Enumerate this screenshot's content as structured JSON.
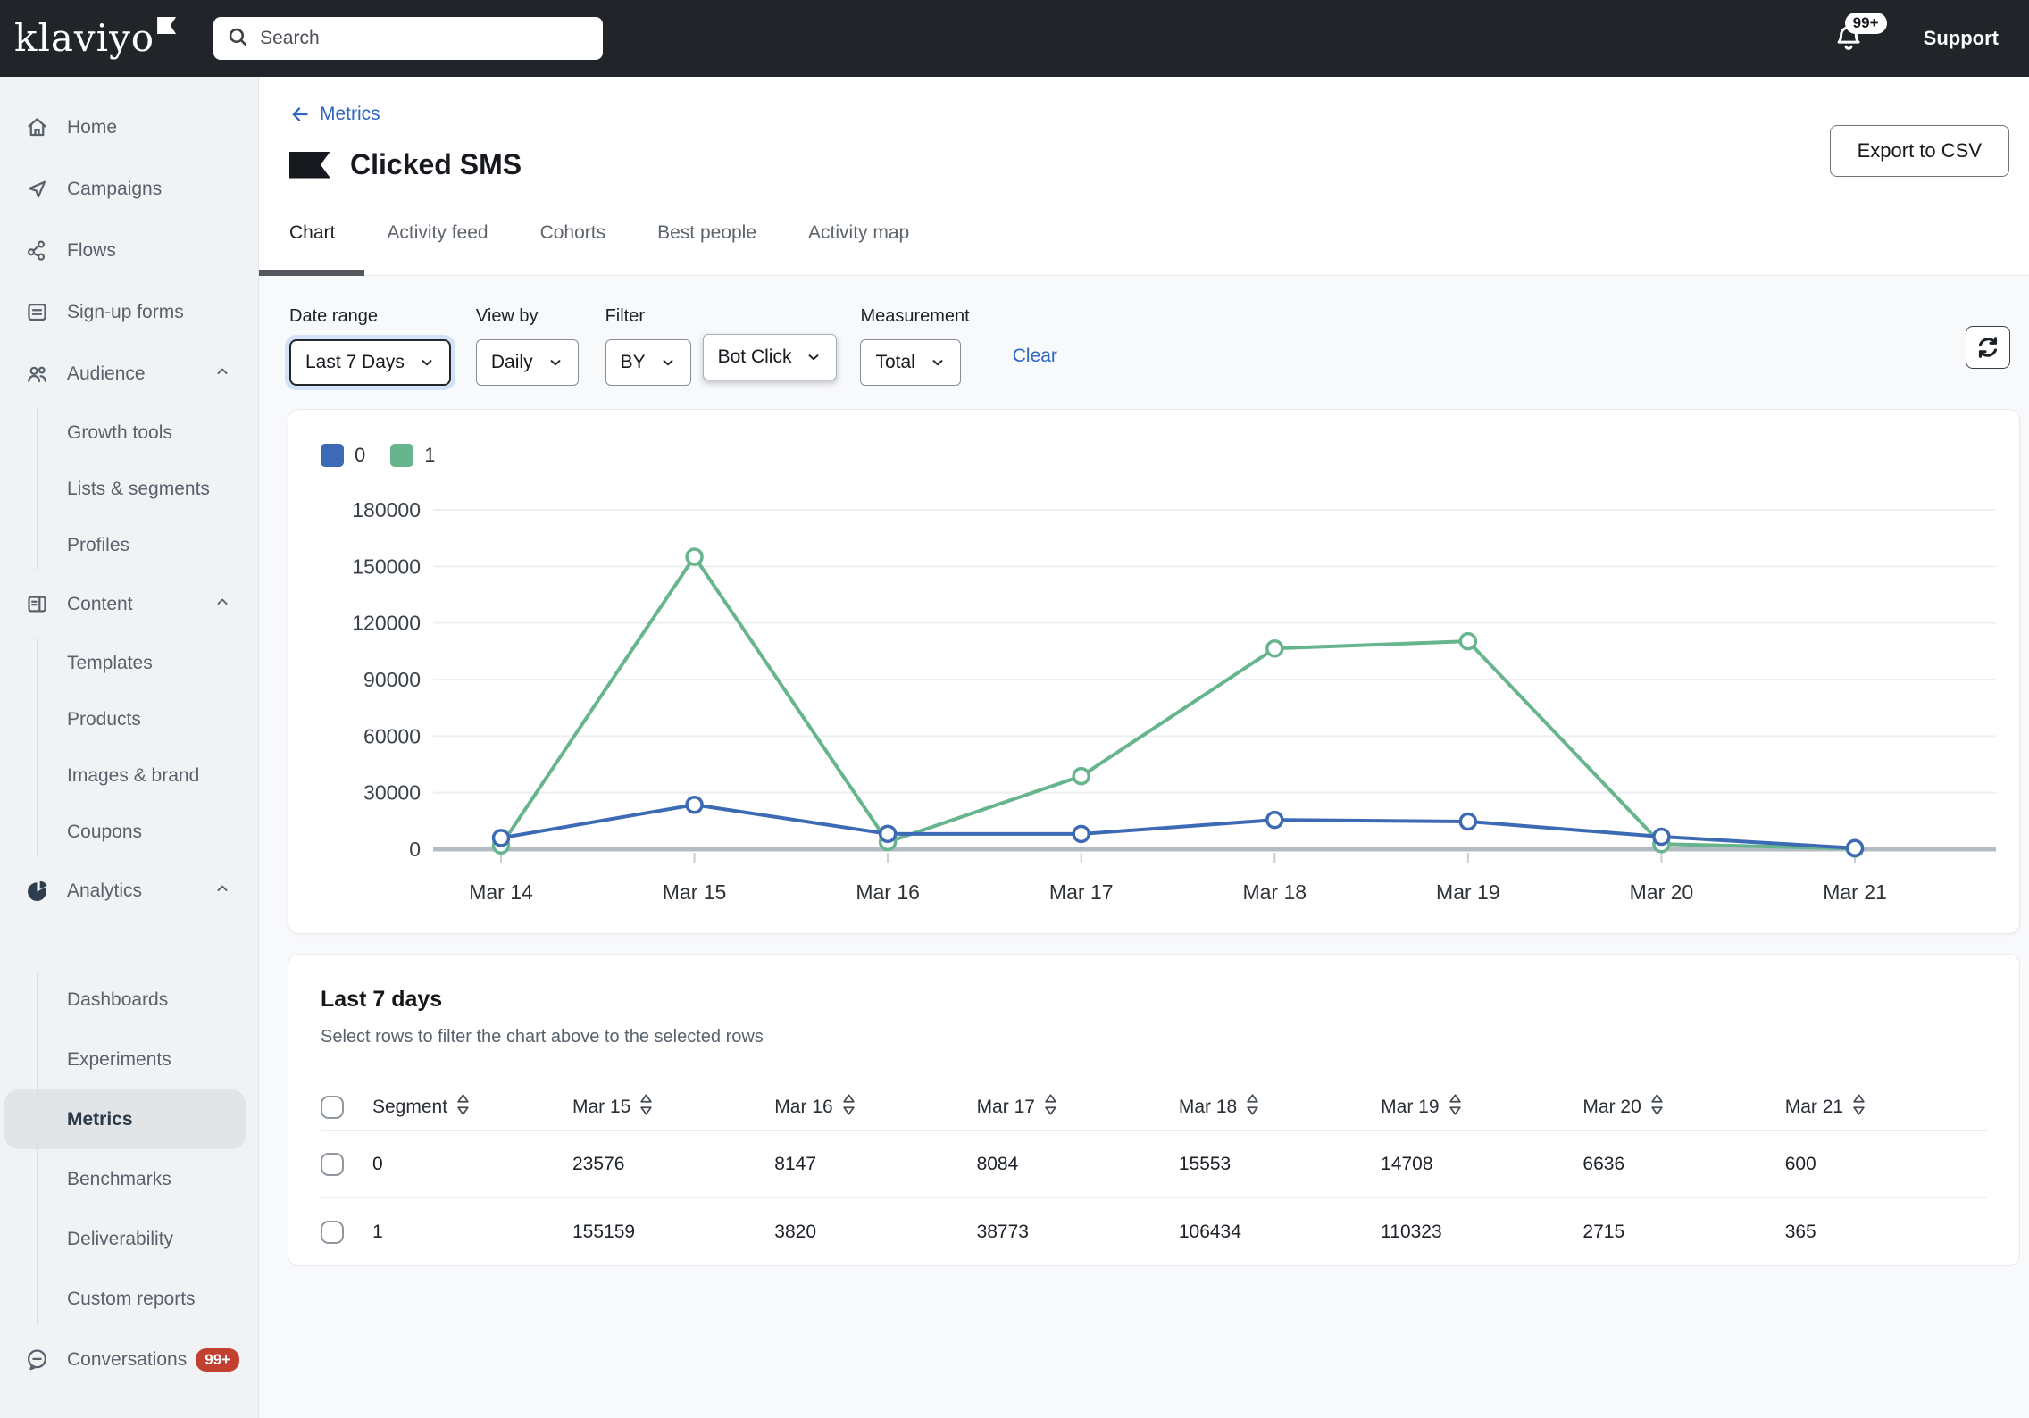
{
  "topbar": {
    "logo": "klaviyo",
    "search_placeholder": "Search",
    "notification_count": "99+",
    "support_label": "Support"
  },
  "sidebar": {
    "items": [
      {
        "label": "Home",
        "icon": "home"
      },
      {
        "label": "Campaigns",
        "icon": "send"
      },
      {
        "label": "Flows",
        "icon": "flows"
      },
      {
        "label": "Sign-up forms",
        "icon": "form"
      },
      {
        "label": "Audience",
        "icon": "audience",
        "expanded": true,
        "children": [
          "Growth tools",
          "Lists & segments",
          "Profiles"
        ]
      },
      {
        "label": "Content",
        "icon": "content",
        "expanded": true,
        "children": [
          "Templates",
          "Products",
          "Images & brand",
          "Coupons"
        ]
      },
      {
        "label": "Analytics",
        "icon": "analytics",
        "expanded": true,
        "children": [
          "Dashboards",
          "Experiments",
          "Metrics",
          "Benchmarks",
          "Deliverability",
          "Custom reports"
        ],
        "active_child": "Metrics"
      },
      {
        "label": "Conversations",
        "icon": "chat",
        "badge": "99+"
      }
    ]
  },
  "header": {
    "breadcrumb": "Metrics",
    "title": "Clicked SMS",
    "export_label": "Export to CSV",
    "tabs": [
      "Chart",
      "Activity feed",
      "Cohorts",
      "Best people",
      "Activity map"
    ],
    "active_tab": "Chart"
  },
  "filters": {
    "date_range": {
      "label": "Date range",
      "value": "Last 7 Days"
    },
    "view_by": {
      "label": "View by",
      "value": "Daily"
    },
    "filter": {
      "label": "Filter",
      "field": "BY",
      "value": "Bot Click"
    },
    "measurement": {
      "label": "Measurement",
      "value": "Total"
    },
    "clear_label": "Clear"
  },
  "chart_data": {
    "type": "line",
    "x": [
      "Mar 14",
      "Mar 15",
      "Mar 16",
      "Mar 17",
      "Mar 18",
      "Mar 19",
      "Mar 20",
      "Mar 21"
    ],
    "series": [
      {
        "name": "0",
        "color": "#3d6ab5",
        "values": [
          6000,
          23576,
          8147,
          8084,
          15553,
          14708,
          6636,
          600
        ]
      },
      {
        "name": "1",
        "color": "#67b58c",
        "values": [
          2000,
          155159,
          3820,
          38773,
          106434,
          110323,
          2715,
          365
        ]
      }
    ],
    "ylim": [
      0,
      180000
    ],
    "yticks": [
      0,
      30000,
      60000,
      90000,
      120000,
      150000,
      180000
    ],
    "grid": true,
    "legend_position": "top-left"
  },
  "table": {
    "title": "Last 7 days",
    "subtitle": "Select rows to filter the chart above to the selected rows",
    "columns": [
      "Segment",
      "Mar 15",
      "Mar 16",
      "Mar 17",
      "Mar 18",
      "Mar 19",
      "Mar 20",
      "Mar 21"
    ],
    "rows": [
      {
        "segment": "0",
        "values": [
          23576,
          8147,
          8084,
          15553,
          14708,
          6636,
          600
        ]
      },
      {
        "segment": "1",
        "values": [
          155159,
          3820,
          38773,
          106434,
          110323,
          2715,
          365
        ]
      }
    ]
  }
}
